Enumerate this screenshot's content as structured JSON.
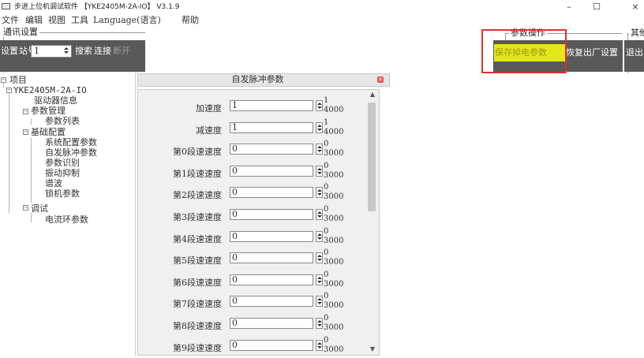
{
  "window": {
    "title": "步进上位机调试软件 【YKE2405M-2A-IO】 V3.1.9",
    "controls": {
      "minimize": "–",
      "maximize": "☐",
      "close": "×"
    }
  },
  "menu": {
    "file": "文件",
    "edit": "编辑",
    "view": "视图",
    "tools": "工具",
    "language": "Language(语言)",
    "help": "帮助"
  },
  "comm": {
    "group_title": "通讯设置",
    "settings": "设置",
    "station_label": "站号:",
    "station_value": "1",
    "search": "搜索",
    "connect": "连接",
    "disconnect": "断开"
  },
  "params_ops": {
    "group_title": "参数操作",
    "save": "保存掉电参数",
    "restore": "恢复出厂设置"
  },
  "other": {
    "group_title": "其他",
    "exit": "退出"
  },
  "tree": {
    "root": "项目",
    "device": "YKE2405M-2A-IO",
    "items": {
      "driver_info": "驱动器信息",
      "param_mgmt": "参数管理",
      "param_list": "参数列表",
      "basic_config": "基础配置",
      "sys_config": "系统配置参数",
      "auto_pulse": "自发脉冲参数",
      "param_identify": "参数识别",
      "vibration": "振动抑制",
      "spectrum": "谱波",
      "lock_params": "锁机参数",
      "debug": "调试",
      "current_loop": "电流环参数"
    }
  },
  "tab": {
    "title": "自发脉冲参数"
  },
  "params": [
    {
      "label": "加速度",
      "value": "1",
      "min": "1",
      "max": "4000"
    },
    {
      "label": "减速度",
      "value": "1",
      "min": "1",
      "max": "4000"
    },
    {
      "label": "第0段速速度",
      "value": "0",
      "min": "0",
      "max": "3000"
    },
    {
      "label": "第1段速速度",
      "value": "0",
      "min": "0",
      "max": "3000"
    },
    {
      "label": "第2段速速度",
      "value": "0",
      "min": "0",
      "max": "3000"
    },
    {
      "label": "第3段速速度",
      "value": "0",
      "min": "0",
      "max": "3000"
    },
    {
      "label": "第4段速速度",
      "value": "0",
      "min": "0",
      "max": "3000"
    },
    {
      "label": "第5段速速度",
      "value": "0",
      "min": "0",
      "max": "3000"
    },
    {
      "label": "第6段速速度",
      "value": "0",
      "min": "0",
      "max": "3000"
    },
    {
      "label": "第7段速速度",
      "value": "0",
      "min": "0",
      "max": "3000"
    },
    {
      "label": "第8段速速度",
      "value": "0",
      "min": "0",
      "max": "3000"
    },
    {
      "label": "第9段速速度",
      "value": "0",
      "min": "0",
      "max": "3000"
    }
  ],
  "colors": {
    "toolbar_strip": "#595959",
    "save_button_bg": "#e3e61a",
    "highlight": "#e03030",
    "tab_close": "#e05050"
  }
}
